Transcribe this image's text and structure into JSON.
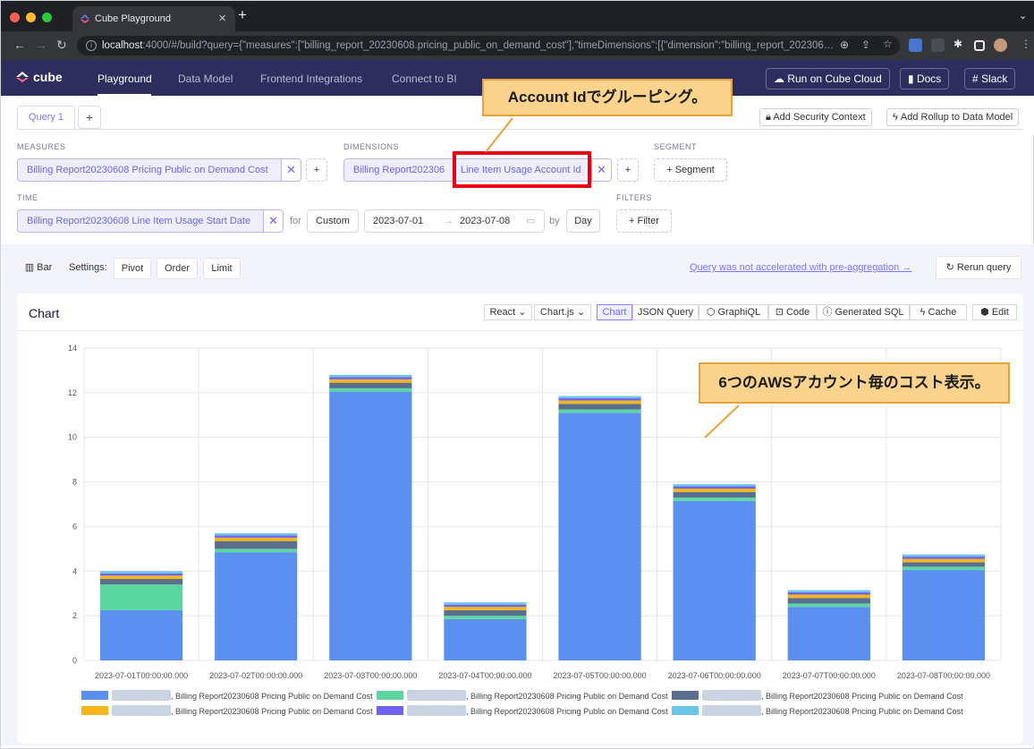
{
  "browser": {
    "tab_title": "Cube Playground",
    "new_tab": "+",
    "tab_close": "×",
    "url_host": "localhost",
    "url_rest": ":4000/#/build?query={\"measures\":[\"billing_report_20230608.pricing_public_on_demand_cost\"],\"timeDimensions\":[{\"dimension\":\"billing_report_202306…"
  },
  "nav": {
    "brand": "cube",
    "items": [
      "Playground",
      "Data Model",
      "Frontend Integrations",
      "Connect to BI"
    ],
    "run_cloud": "Run on Cube Cloud",
    "docs": "Docs",
    "slack": "Slack"
  },
  "query_tabs": {
    "tab": "Query 1",
    "add": "+"
  },
  "top_actions": {
    "security": "Add Security Context",
    "rollup": "Add Rollup to Data Model"
  },
  "builder": {
    "measures_label": "MEASURES",
    "measure": "Billing Report20230608 Pricing Public on Demand Cost",
    "dimensions_label": "DIMENSIONS",
    "dimension": "Billing Report20230608 Line Item Usage Account Id",
    "dimension_visible_suffix": "Line Item Usage Account Id",
    "dimension_visible_prefix": "Billing Report202306",
    "segment_label": "SEGMENT",
    "segment_btn": "+ Segment",
    "time_label": "TIME",
    "time": "Billing Report20230608 Line Item Usage Start Date",
    "for": "for",
    "range_type": "Custom",
    "date_from": "2023-07-01",
    "date_to": "2023-07-08",
    "by": "by",
    "granularity": "Day",
    "filters_label": "FILTERS",
    "filter_btn": "+ Filter"
  },
  "toolbar": {
    "chart_type": "Bar",
    "settings": "Settings:",
    "pivot": "Pivot",
    "order": "Order",
    "limit": "Limit",
    "preagg_link": "Query was not accelerated with pre-aggregation →",
    "rerun": "Rerun query"
  },
  "chart_card": {
    "title": "Chart",
    "framework": "React",
    "library": "Chart.js",
    "tabs": [
      "Chart",
      "JSON Query",
      "GraphiQL",
      "Code",
      "Generated SQL",
      "Cache",
      "Edit"
    ]
  },
  "annotations": {
    "group": "Account Idでグルーピング。",
    "cost": "6つのAWSアカウント毎のコスト表示。"
  },
  "colors": {
    "accent": "#7a77ff",
    "nav_bg": "#2e2e5e",
    "callout_fill": "#fbd38d",
    "red": "#e60012"
  },
  "chart_data": {
    "type": "bar",
    "stacked": true,
    "categories": [
      "2023-07-01T00:00:00.000",
      "2023-07-02T00:00:00.000",
      "2023-07-03T00:00:00.000",
      "2023-07-04T00:00:00.000",
      "2023-07-05T00:00:00.000",
      "2023-07-06T00:00:00.000",
      "2023-07-07T00:00:00.000",
      "2023-07-08T00:00:00.000"
    ],
    "ylim": [
      0,
      14
    ],
    "yticks": [
      0,
      2,
      4,
      6,
      8,
      10,
      12,
      14
    ],
    "grid": true,
    "legend_position": "bottom",
    "series": [
      {
        "name": ", Billing Report20230608 Pricing Public on Demand Cost",
        "color": "#5b8ff0",
        "values": [
          2.25,
          4.85,
          12.05,
          1.85,
          11.1,
          7.15,
          2.4,
          4.05
        ]
      },
      {
        "name": ", Billing Report20230608 Pricing Public on Demand Cost",
        "color": "#5cd6a0",
        "values": [
          1.15,
          0.15,
          0.15,
          0.15,
          0.15,
          0.15,
          0.15,
          0.15
        ]
      },
      {
        "name": ", Billing Report20230608 Pricing Public on Demand Cost",
        "color": "#5a6e8e",
        "values": [
          0.25,
          0.35,
          0.25,
          0.25,
          0.25,
          0.25,
          0.25,
          0.2
        ]
      },
      {
        "name": ", Billing Report20230608 Pricing Public on Demand Cost",
        "color": "#f5b61c",
        "values": [
          0.15,
          0.15,
          0.15,
          0.15,
          0.15,
          0.15,
          0.15,
          0.15
        ]
      },
      {
        "name": ", Billing Report20230608 Pricing Public on Demand Cost",
        "color": "#7161ef",
        "values": [
          0.1,
          0.1,
          0.1,
          0.1,
          0.1,
          0.1,
          0.1,
          0.1
        ]
      },
      {
        "name": ", Billing Report20230608 Pricing Public on Demand Cost",
        "color": "#6cc4e8",
        "values": [
          0.1,
          0.1,
          0.1,
          0.1,
          0.1,
          0.1,
          0.1,
          0.1
        ]
      }
    ]
  }
}
